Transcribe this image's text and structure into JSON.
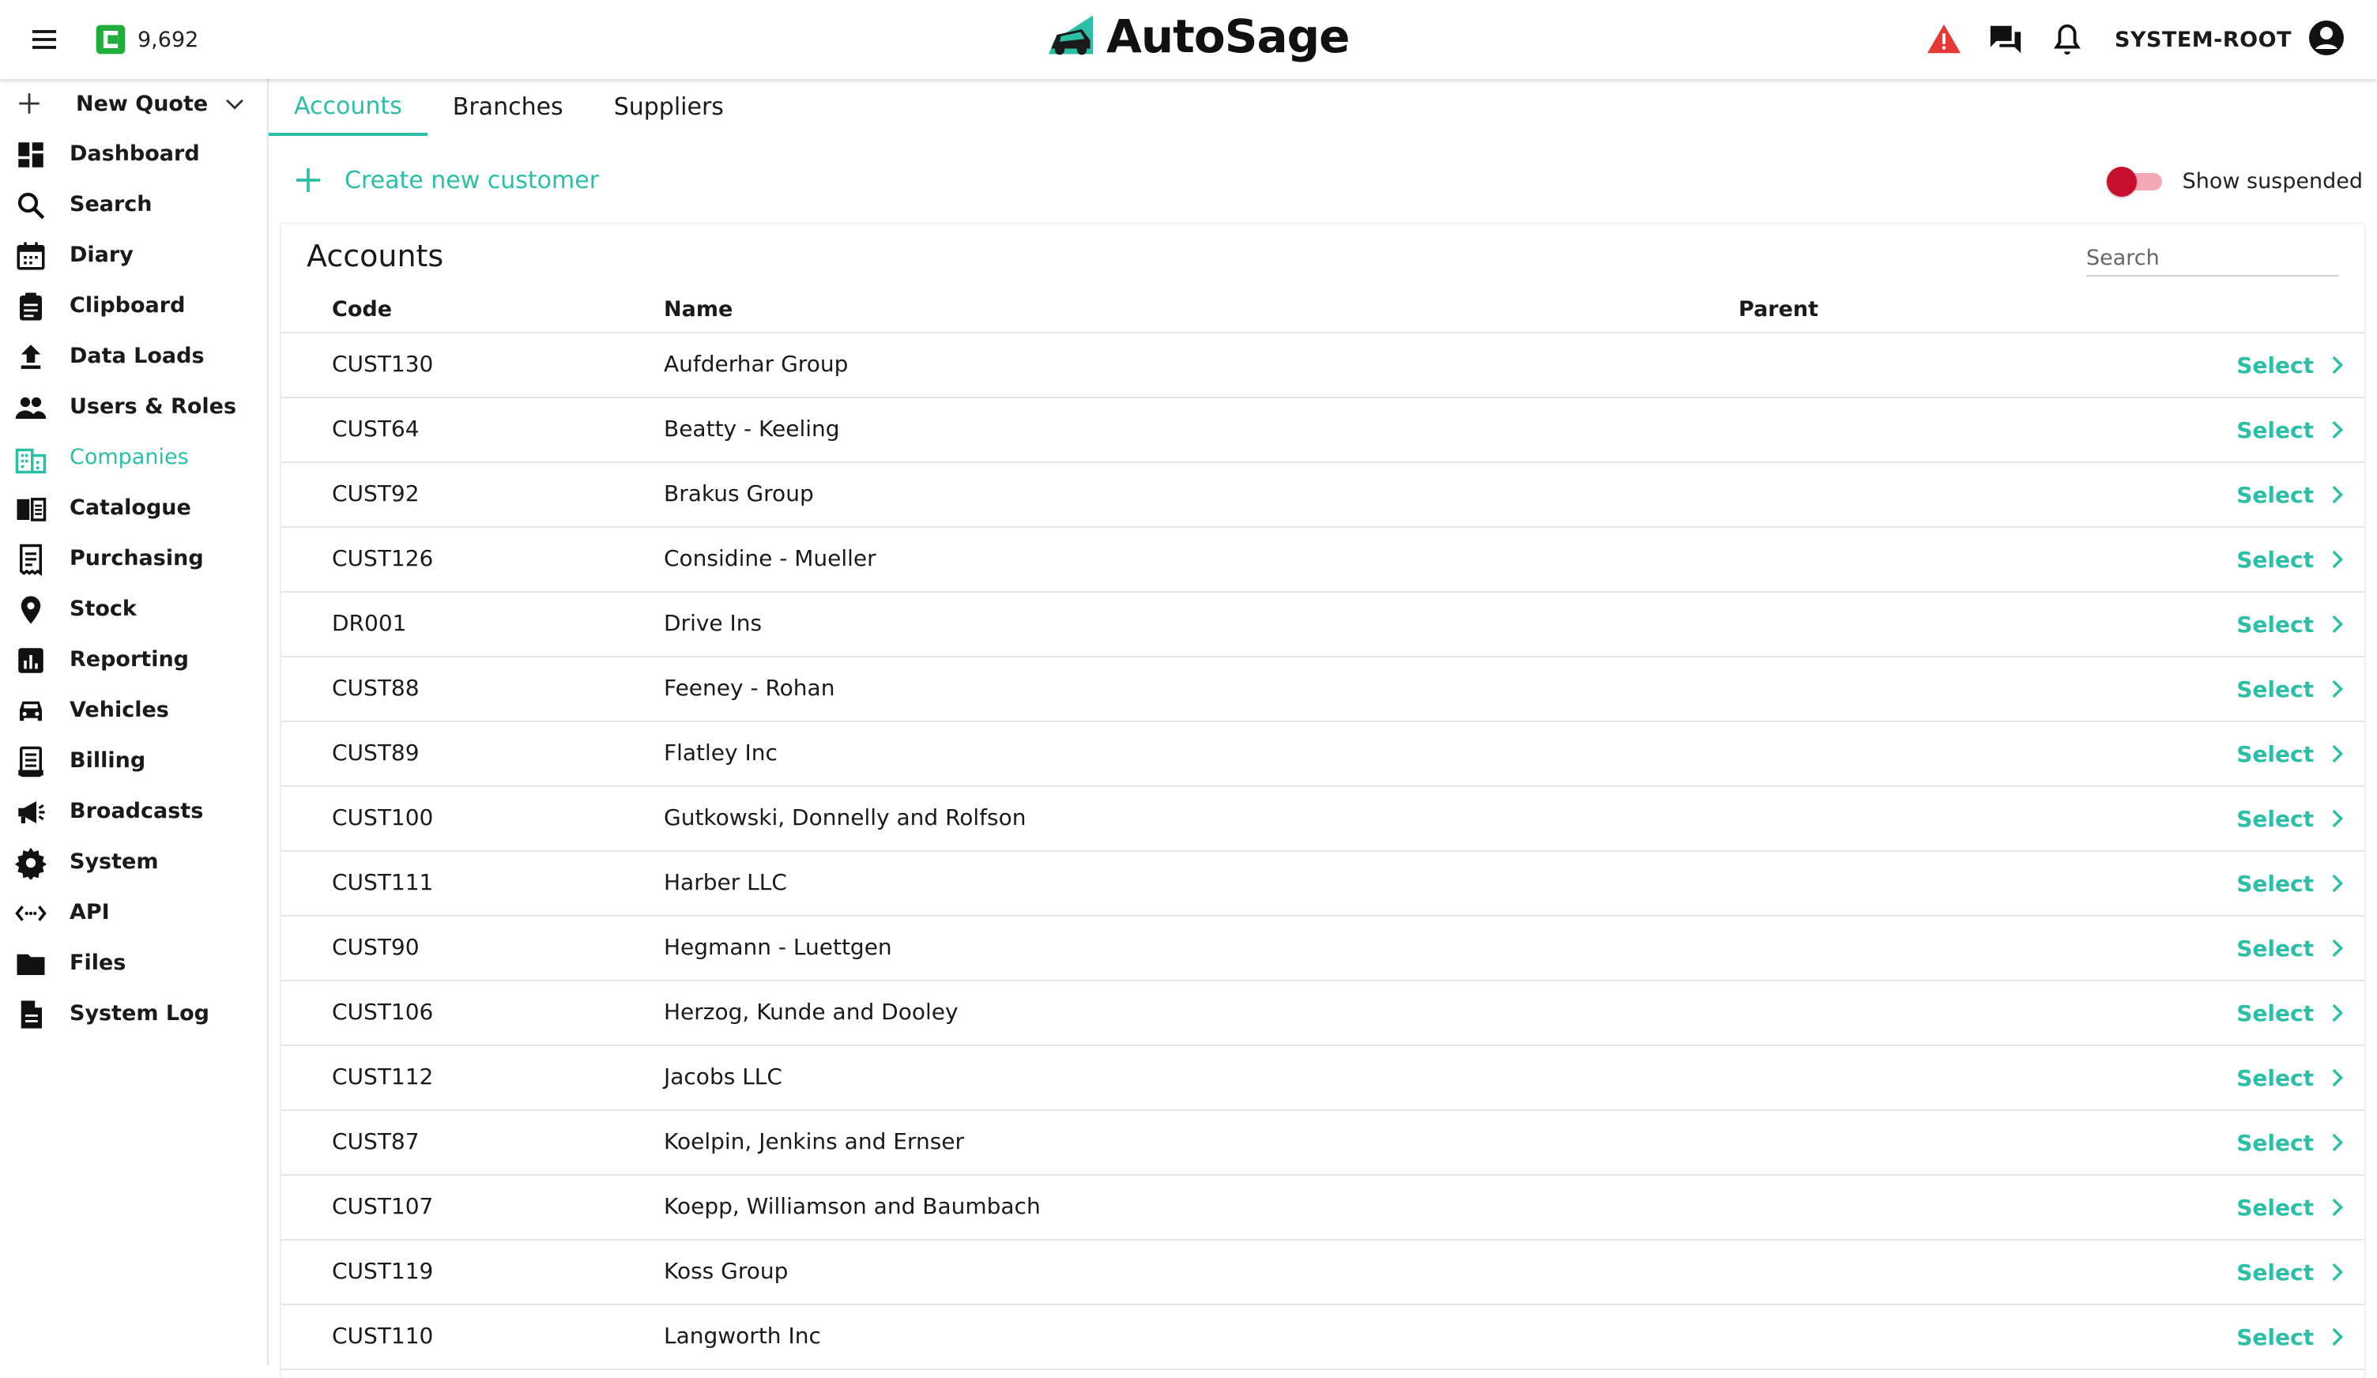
{
  "header": {
    "credits": "9,692",
    "brand": "AutoSage",
    "username": "SYSTEM-ROOT",
    "icons": [
      "menu-icon",
      "credits-icon",
      "autosage-logo",
      "warning-icon",
      "chat-icon",
      "bell-icon",
      "account-circle-icon"
    ],
    "warning_color": "#e53935"
  },
  "sidebar": {
    "new_quote": "New Quote",
    "items": [
      {
        "label": "Dashboard",
        "icon": "dashboard-icon"
      },
      {
        "label": "Search",
        "icon": "search-icon"
      },
      {
        "label": "Diary",
        "icon": "calendar-icon"
      },
      {
        "label": "Clipboard",
        "icon": "clipboard-icon"
      },
      {
        "label": "Data Loads",
        "icon": "upload-icon"
      },
      {
        "label": "Users & Roles",
        "icon": "people-icon"
      },
      {
        "label": "Companies",
        "icon": "building-icon",
        "active": true
      },
      {
        "label": "Catalogue",
        "icon": "book-icon"
      },
      {
        "label": "Purchasing",
        "icon": "receipt-icon"
      },
      {
        "label": "Stock",
        "icon": "location-pin-icon"
      },
      {
        "label": "Reporting",
        "icon": "bar-chart-icon"
      },
      {
        "label": "Vehicles",
        "icon": "car-icon"
      },
      {
        "label": "Billing",
        "icon": "receipt-long-icon"
      },
      {
        "label": "Broadcasts",
        "icon": "megaphone-icon"
      },
      {
        "label": "System",
        "icon": "gear-icon"
      },
      {
        "label": "API",
        "icon": "api-icon"
      },
      {
        "label": "Files",
        "icon": "folder-icon"
      },
      {
        "label": "System Log",
        "icon": "document-icon"
      }
    ]
  },
  "tabs": [
    "Accounts",
    "Branches",
    "Suppliers"
  ],
  "actions": {
    "create": "Create new customer",
    "show_suspended": "Show suspended"
  },
  "table": {
    "title": "Accounts",
    "search_placeholder": "Search",
    "columns": [
      "Code",
      "Name",
      "Parent"
    ],
    "select_label": "Select",
    "rows": [
      {
        "code": "CUST130",
        "name": "Aufderhar Group",
        "parent": ""
      },
      {
        "code": "CUST64",
        "name": "Beatty - Keeling",
        "parent": ""
      },
      {
        "code": "CUST92",
        "name": "Brakus Group",
        "parent": ""
      },
      {
        "code": "CUST126",
        "name": "Considine - Mueller",
        "parent": ""
      },
      {
        "code": "DR001",
        "name": "Drive Ins",
        "parent": ""
      },
      {
        "code": "CUST88",
        "name": "Feeney - Rohan",
        "parent": ""
      },
      {
        "code": "CUST89",
        "name": "Flatley Inc",
        "parent": ""
      },
      {
        "code": "CUST100",
        "name": "Gutkowski, Donnelly and Rolfson",
        "parent": ""
      },
      {
        "code": "CUST111",
        "name": "Harber LLC",
        "parent": ""
      },
      {
        "code": "CUST90",
        "name": "Hegmann - Luettgen",
        "parent": ""
      },
      {
        "code": "CUST106",
        "name": "Herzog, Kunde and Dooley",
        "parent": ""
      },
      {
        "code": "CUST112",
        "name": "Jacobs LLC",
        "parent": ""
      },
      {
        "code": "CUST87",
        "name": "Koelpin, Jenkins and Ernser",
        "parent": ""
      },
      {
        "code": "CUST107",
        "name": "Koepp, Williamson and Baumbach",
        "parent": ""
      },
      {
        "code": "CUST119",
        "name": "Koss Group",
        "parent": ""
      },
      {
        "code": "CUST110",
        "name": "Langworth Inc",
        "parent": ""
      }
    ]
  },
  "colors": {
    "accent": "#2bbfa8",
    "toggle": "#c8102e"
  }
}
